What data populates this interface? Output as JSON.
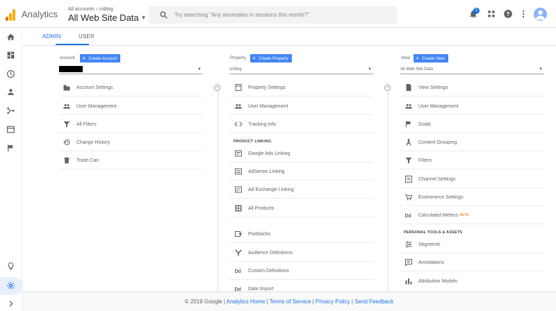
{
  "header": {
    "app_name": "Analytics",
    "breadcrumb": "All accounts › cnblog",
    "property_view": "All Web Site Data",
    "search_placeholder": "Try searching \"Any anomalies in sessions this month?\"",
    "notification_count": "1"
  },
  "tabs": [
    {
      "label": "ADMIN",
      "active": true
    },
    {
      "label": "USER",
      "active": false
    }
  ],
  "account": {
    "label": "Account",
    "create_label": "Create Account",
    "selected": "",
    "items": [
      {
        "label": "Account Settings",
        "icon": "building-icon"
      },
      {
        "label": "User Management",
        "icon": "users-icon"
      },
      {
        "label": "All Filters",
        "icon": "filter-icon"
      },
      {
        "label": "Change History",
        "icon": "history-icon"
      },
      {
        "label": "Trash Can",
        "icon": "trash-icon"
      }
    ]
  },
  "property": {
    "label": "Property",
    "create_label": "Create Property",
    "selected": "cnblog",
    "items": [
      {
        "label": "Property Settings",
        "icon": "settings-page-icon"
      },
      {
        "label": "User Management",
        "icon": "users-icon"
      },
      {
        "label": "Tracking Info",
        "icon": "code-icon"
      }
    ],
    "section_label": "PRODUCT LINKING",
    "linking_items": [
      {
        "label": "Google Ads Linking",
        "icon": "ads-icon"
      },
      {
        "label": "AdSense Linking",
        "icon": "adsense-icon"
      },
      {
        "label": "Ad Exchange Linking",
        "icon": "ad-exchange-icon"
      },
      {
        "label": "All Products",
        "icon": "products-icon"
      }
    ],
    "more_items": [
      {
        "label": "Postbacks",
        "icon": "postback-icon"
      },
      {
        "label": "Audience Definitions",
        "icon": "audience-icon"
      },
      {
        "label": "Custom Definitions",
        "icon": "dd-icon"
      },
      {
        "label": "Data Import",
        "icon": "dd-icon"
      }
    ]
  },
  "view": {
    "label": "View",
    "create_label": "Create View",
    "selected": "All Web Site Data",
    "items": [
      {
        "label": "View Settings",
        "icon": "document-icon"
      },
      {
        "label": "User Management",
        "icon": "users-icon"
      },
      {
        "label": "Goals",
        "icon": "flag-icon"
      },
      {
        "label": "Content Grouping",
        "icon": "grouping-icon"
      },
      {
        "label": "Filters",
        "icon": "filter-icon"
      },
      {
        "label": "Channel Settings",
        "icon": "channel-icon"
      },
      {
        "label": "Ecommerce Settings",
        "icon": "cart-icon"
      },
      {
        "label": "Calculated Metrics",
        "icon": "dd-icon",
        "badge": "BETA"
      }
    ],
    "section_label": "PERSONAL TOOLS & ASSETS",
    "tool_items": [
      {
        "label": "Segments",
        "icon": "segments-icon"
      },
      {
        "label": "Annotations",
        "icon": "annotation-icon"
      },
      {
        "label": "Attribution Models",
        "icon": "bar-chart-icon"
      }
    ]
  },
  "footer": {
    "copyright": "© 2019 Google",
    "links": [
      "Analytics Home",
      "Terms of Service",
      "Privacy Policy",
      "Send Feedback"
    ]
  },
  "colors": {
    "accent": "#1a73e8",
    "button": "#4285f4",
    "logo_orange": "#f9ab00"
  }
}
